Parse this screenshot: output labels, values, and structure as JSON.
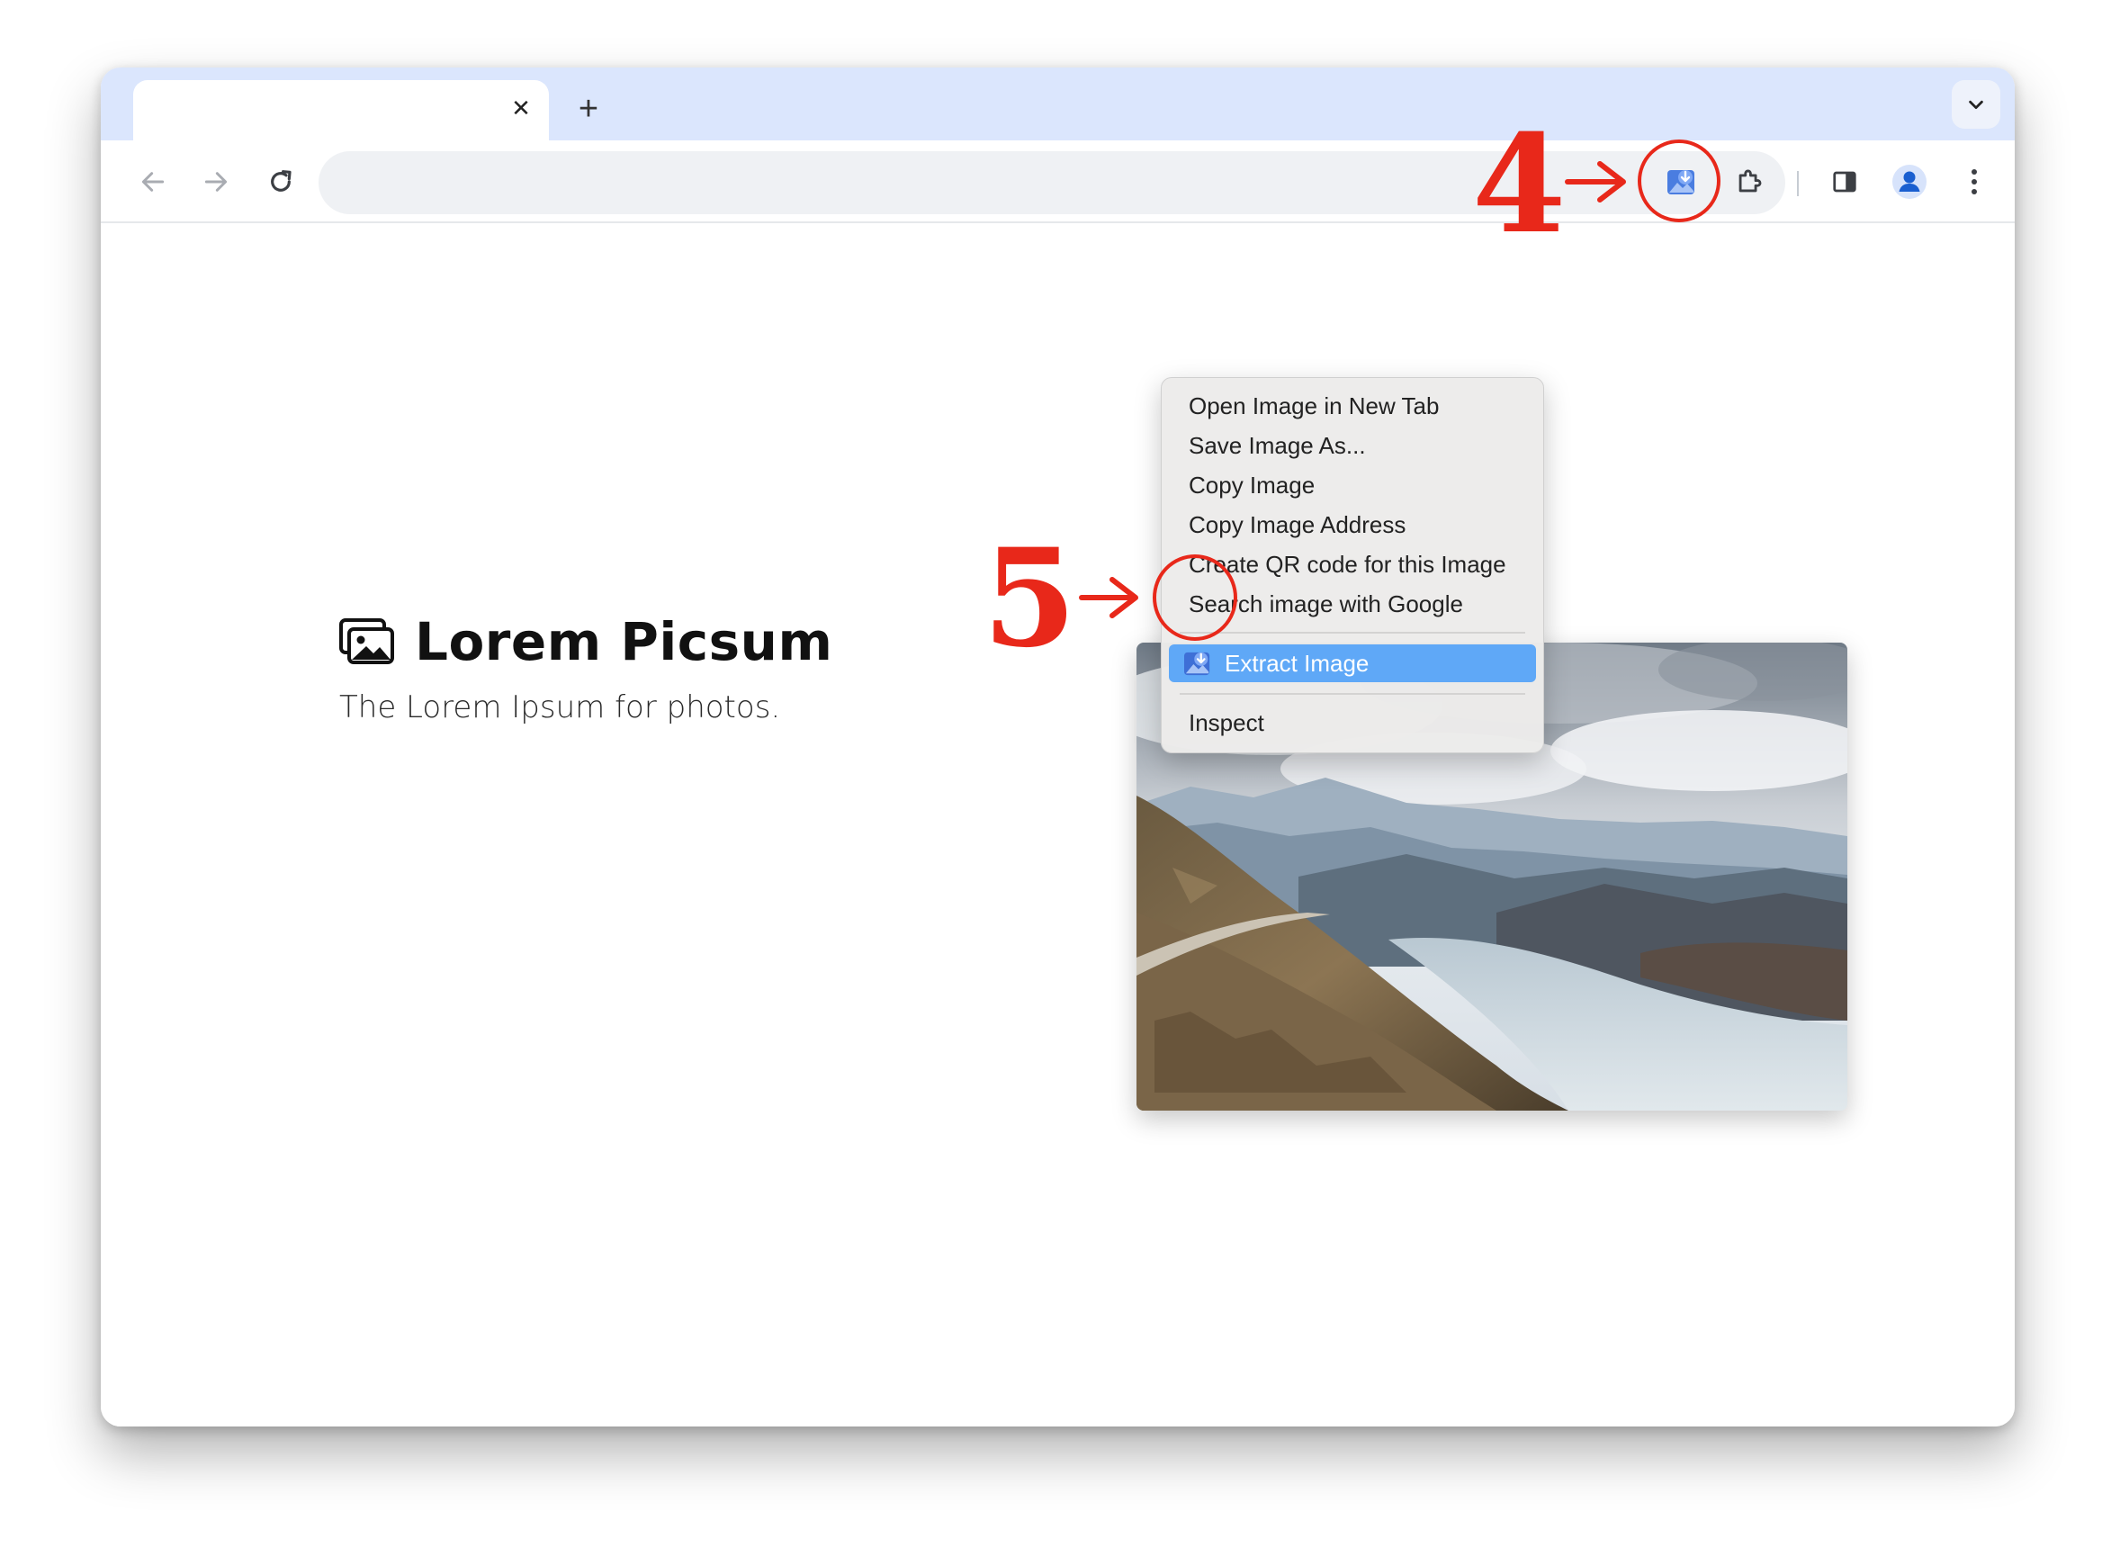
{
  "browser": {
    "tab_close_glyph": "✕",
    "new_tab_glyph": "+",
    "toolbar_icons": [
      "back-arrow-icon",
      "forward-arrow-icon",
      "reload-icon",
      "image-extractor-extension-icon",
      "extensions-puzzle-icon",
      "side-panel-icon",
      "profile-icon",
      "more-menu-icon"
    ],
    "accent_color": "#dbe6fd"
  },
  "page": {
    "brand_title": "Lorem Picsum",
    "tagline": "The Lorem Ipsum for photos."
  },
  "context_menu": {
    "items": [
      "Open Image in New Tab",
      "Save Image As...",
      "Copy Image",
      "Copy Image Address",
      "Create QR code for this Image",
      "Search image with Google"
    ],
    "extension_item": "Extract Image",
    "inspect_item": "Inspect",
    "highlight_color": "#5fa8f7"
  },
  "annotations": {
    "step_toolbar": "4",
    "step_menu": "5",
    "color": "#e8281a"
  }
}
